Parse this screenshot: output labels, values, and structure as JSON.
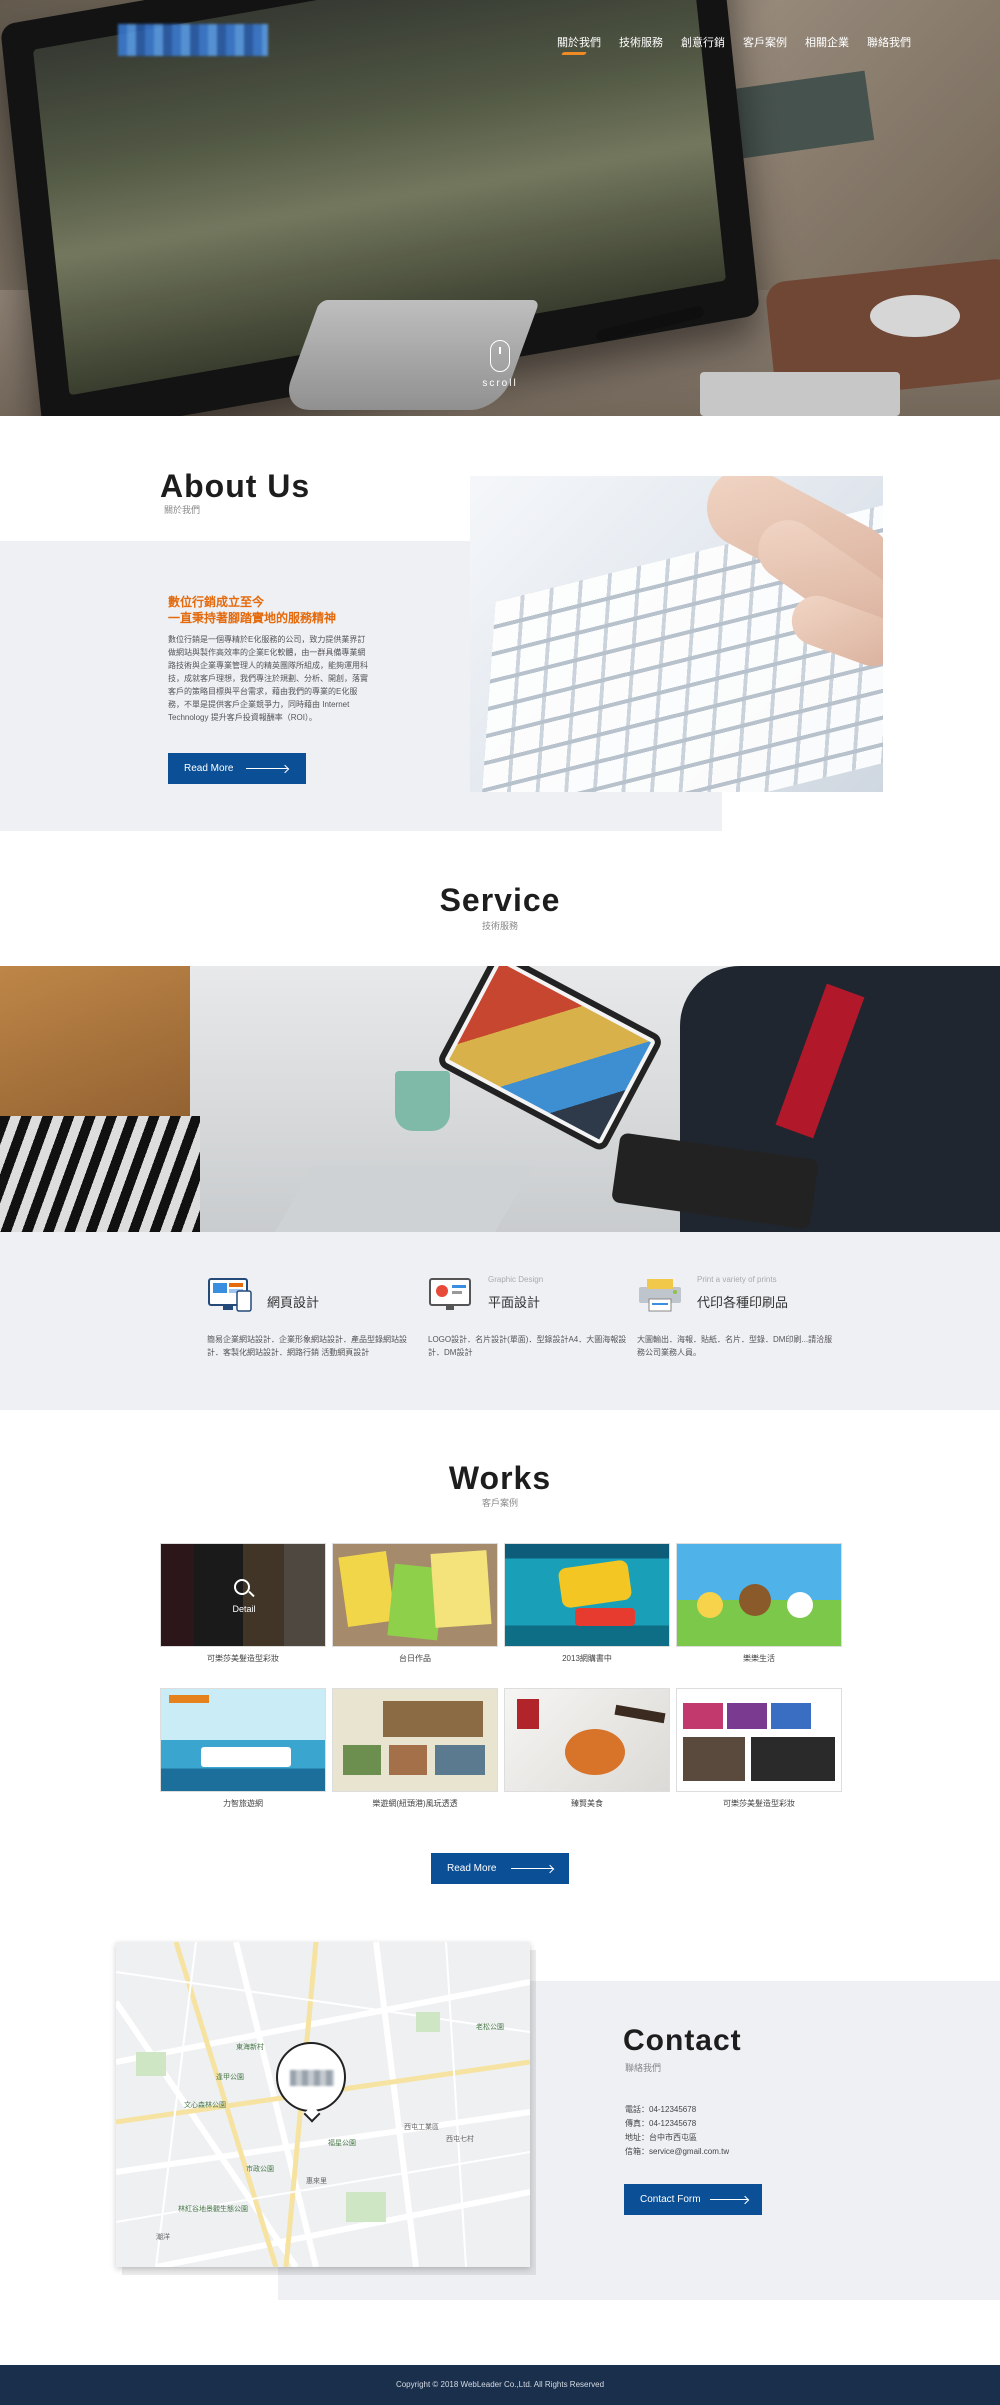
{
  "header": {
    "nav": [
      "關於我們",
      "技術服務",
      "創意行銷",
      "客戶案例",
      "相關企業",
      "聯絡我們"
    ],
    "scroll_label": "scroll"
  },
  "about": {
    "title": "About Us",
    "subtitle": "關於我們",
    "heading_line1": "數位行銷成立至今",
    "heading_line2": "一直秉持著腳踏實地的服務精神",
    "body": "數位行銷是一個專精於E化服務的公司，致力提供業界訂做網站與製作高效率的企業E化軟體，由一群具備專業網路技術與企業專業管理人的精英團隊所組成，能夠運用科技，成就客戶理想，我們專注於規劃、分析、開創，落實客戶的策略目標與平台需求，藉由我們的專業的E化服務，不單是提供客戶企業競爭力，同時藉由 Internet Technology 提升客戶投資報酬率（ROI）。",
    "button": "Read More"
  },
  "service": {
    "title": "Service",
    "subtitle": "技術服務",
    "items": [
      {
        "en": "",
        "zh": "網頁設計",
        "desc": "簡易企業網站設計．企業形象網站設計．產品型錄網站設計．客製化網站設計．網路行銷 活動網頁設計"
      },
      {
        "en": "Graphic Design",
        "zh": "平面設計",
        "desc": "LOGO設計．名片設計(單面)．型錄設計A4．大圖海報設計．DM設計"
      },
      {
        "en": "Print a variety of prints",
        "zh": "代印各種印刷品",
        "desc": "大圖輸出．海報．貼紙．名片．型錄．DM印刷...請洽服務公司業務人員。"
      }
    ]
  },
  "works": {
    "title": "Works",
    "subtitle": "客戶案例",
    "detail_label": "Detail",
    "items": [
      {
        "caption": "可樂莎美髮造型彩妝"
      },
      {
        "caption": "台日作品"
      },
      {
        "caption": "2013網購書中"
      },
      {
        "caption": "樂樂生活"
      },
      {
        "caption": "力智旅遊網"
      },
      {
        "caption": "樂遊網(紐頭港)風玩透透"
      },
      {
        "caption": "臻賢美食"
      },
      {
        "caption": "可樂莎美髮造型彩妝"
      }
    ],
    "button": "Read More"
  },
  "contact": {
    "title": "Contact",
    "subtitle": "聯絡我們",
    "phone": "電話：04-12345678",
    "fax": "傳真：04-12345678",
    "address": "地址：台中市西屯區",
    "email": "信箱：service@gmail.com.tw",
    "button": "Contact Form",
    "map_labels": [
      "東海新村",
      "逢甲公園",
      "文心森林公園",
      "西屯工業區",
      "老松公園",
      "西屯七村",
      "福星公園",
      "惠來里",
      "市政公園",
      "林紅谷地景觀生態公園",
      "潮洋"
    ]
  },
  "footer": {
    "copyright": "Copyright © 2018 WebLeader Co.,Ltd. All Rights Reserved"
  },
  "colors": {
    "accent_orange": "#e46a0c",
    "brand_blue": "#0b4f96",
    "footer_navy": "#1a2f4b",
    "panel_gray": "#eef0f4"
  }
}
